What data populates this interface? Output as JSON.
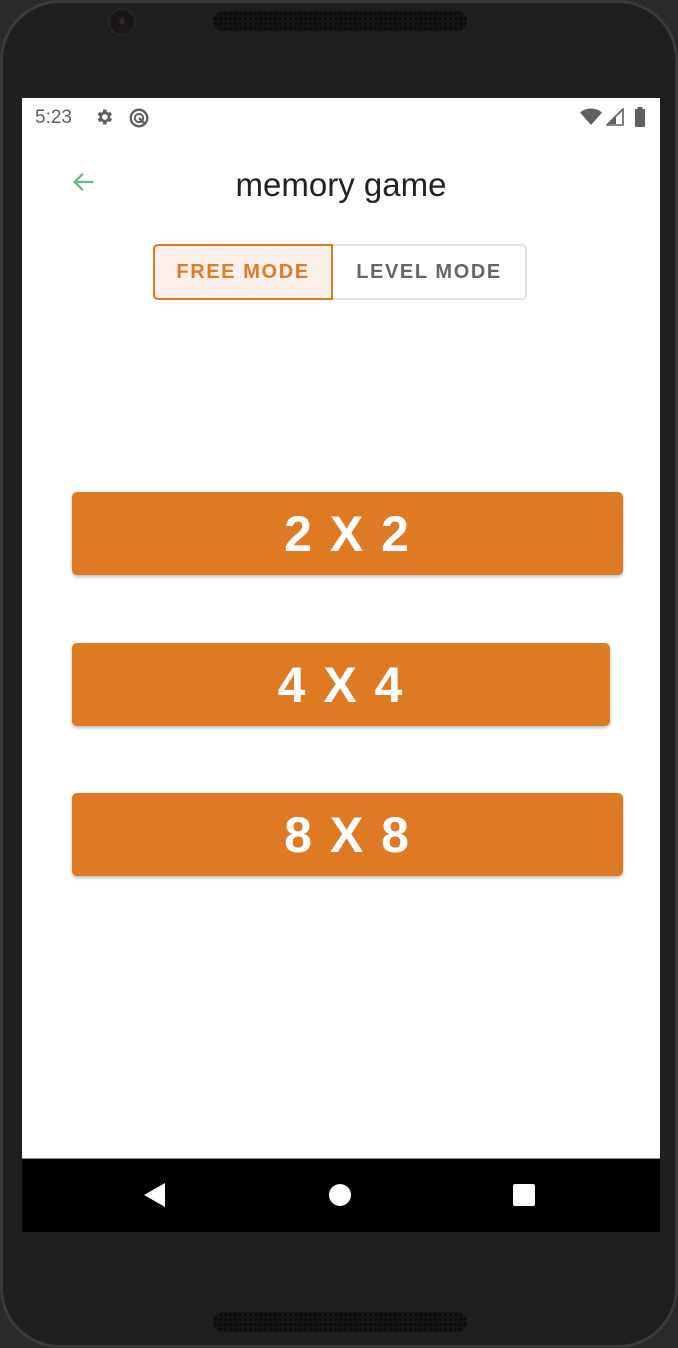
{
  "status_bar": {
    "time": "5:23",
    "left_icons": [
      "gear-icon",
      "do-not-disturb-icon"
    ],
    "right_icons": [
      "wifi-icon",
      "cellular-signal-icon",
      "battery-icon"
    ]
  },
  "app_bar": {
    "back_icon": "arrow-left-icon",
    "title": "memory game",
    "accent_color": "#6bb58a"
  },
  "mode_toggle": {
    "options": [
      {
        "label": "FREE MODE",
        "selected": true
      },
      {
        "label": "LEVEL MODE",
        "selected": false
      }
    ],
    "active_color": "#e07a25"
  },
  "grid_buttons": [
    {
      "label": "2 X 2"
    },
    {
      "label": "4 X 4"
    },
    {
      "label": "8 X 8"
    }
  ],
  "colors": {
    "button_bg": "#de7a24",
    "button_text": "#ffffff"
  },
  "nav_bar": {
    "buttons": [
      "back-triangle-icon",
      "home-circle-icon",
      "recents-square-icon"
    ]
  }
}
